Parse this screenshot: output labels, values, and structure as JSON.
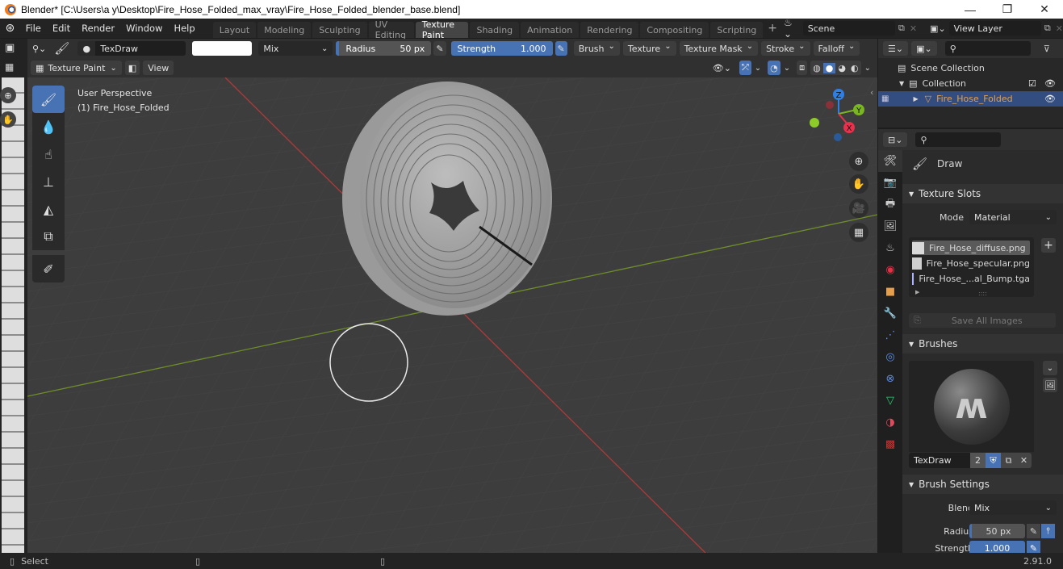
{
  "window": {
    "title": "Blender* [C:\\Users\\a y\\Desktop\\Fire_Hose_Folded_max_vray\\Fire_Hose_Folded_blender_base.blend]",
    "minimize": "—",
    "maximize": "❐",
    "close": "✕"
  },
  "menu": [
    "File",
    "Edit",
    "Render",
    "Window",
    "Help"
  ],
  "workspaces": [
    {
      "label": "Layout",
      "active": false
    },
    {
      "label": "Modeling",
      "active": false
    },
    {
      "label": "Sculpting",
      "active": false
    },
    {
      "label": "UV Editing",
      "active": false
    },
    {
      "label": "Texture Paint",
      "active": true
    },
    {
      "label": "Shading",
      "active": false
    },
    {
      "label": "Animation",
      "active": false
    },
    {
      "label": "Rendering",
      "active": false
    },
    {
      "label": "Compositing",
      "active": false
    },
    {
      "label": "Scripting",
      "active": false
    }
  ],
  "add_workspace": "+",
  "scene": {
    "value": "Scene"
  },
  "view_layer": {
    "value": "View Layer"
  },
  "tool_header": {
    "brush_name": "TexDraw",
    "color": "#ffffff",
    "blend": "Mix",
    "radius_label": "Radius",
    "radius_value": "50 px",
    "strength_label": "Strength",
    "strength_value": "1.000",
    "strength_fraction": 1.0,
    "menus": [
      "Brush",
      "Texture",
      "Texture Mask",
      "Stroke",
      "Falloff"
    ]
  },
  "viewport_header": {
    "mode": "Texture Paint",
    "view": "View"
  },
  "viewport": {
    "perspective": "User Perspective",
    "object": "(1) Fire_Hose_Folded",
    "gizmo": {
      "x": "X",
      "y": "Y",
      "z": "Z"
    }
  },
  "outliner": {
    "scene_collection": "Scene Collection",
    "collection": "Collection",
    "object": "Fire_Hose_Folded"
  },
  "properties": {
    "tool_name": "Draw",
    "texture_slots": {
      "title": "Texture Slots",
      "mode_label": "Mode",
      "mode_value": "Material",
      "slots": [
        {
          "name": "Fire_Hose_diffuse.png",
          "swatch": "#d9d9d9",
          "selected": true
        },
        {
          "name": "Fire_Hose_specular.png",
          "swatch": "#cfcfcf",
          "selected": false
        },
        {
          "name": "Fire_Hose_...al_Bump.tga",
          "swatch": "#aeb4ff",
          "selected": false
        }
      ],
      "save_all": "Save All Images"
    },
    "brushes": {
      "title": "Brushes",
      "name": "TexDraw",
      "users": "2"
    },
    "brush_settings": {
      "title": "Brush Settings",
      "blend_label": "Blend",
      "blend_value": "Mix",
      "radius_label": "Radius",
      "radius_value": "50 px",
      "strength_label": "Strength",
      "strength_value": "1.000"
    }
  },
  "statusbar": {
    "select": "Select",
    "version": "2.91.0"
  },
  "colors": {
    "accent": "#4772b3",
    "x_axis": "#e8314d",
    "y_axis": "#79b61f",
    "z_axis": "#2f80e6",
    "object_orange": "#e39f4e"
  }
}
